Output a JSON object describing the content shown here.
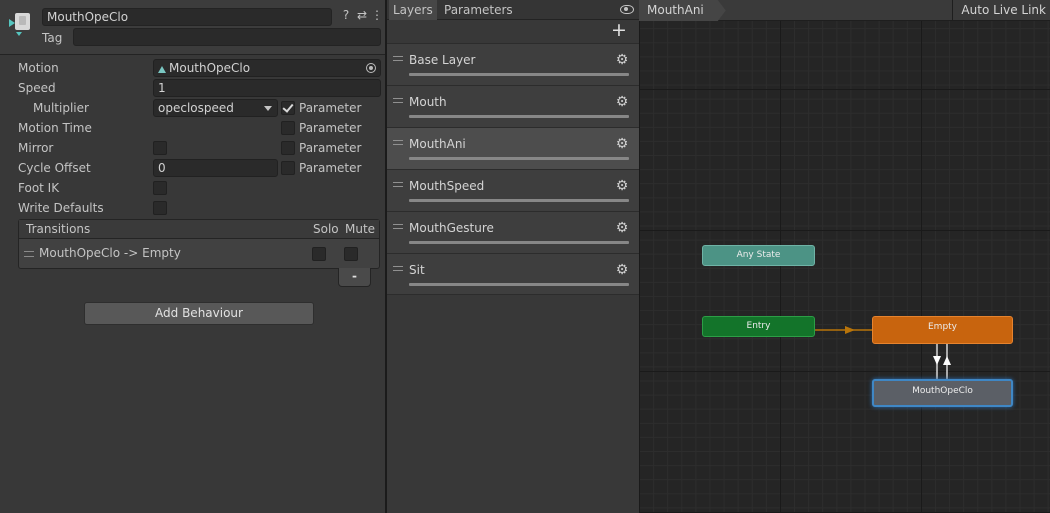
{
  "inspector": {
    "state_name": "MouthOpeClo",
    "tag_label": "Tag",
    "tag_value": "",
    "header_icons": [
      "help-icon",
      "preset-icon",
      "more-icon"
    ],
    "motion": {
      "label": "Motion",
      "value": "MouthOpeClo"
    },
    "speed": {
      "label": "Speed",
      "value": "1"
    },
    "multiplier": {
      "label": "Multiplier",
      "value": "opeclospeed",
      "parameter_label": "Parameter",
      "parameter_checked": true
    },
    "motion_time": {
      "label": "Motion Time",
      "parameter_label": "Parameter",
      "parameter_checked": false
    },
    "mirror": {
      "label": "Mirror",
      "checked": false,
      "parameter_label": "Parameter",
      "parameter_checked": false
    },
    "cycle_offset": {
      "label": "Cycle Offset",
      "value": "0",
      "parameter_label": "Parameter",
      "parameter_checked": false
    },
    "foot_ik": {
      "label": "Foot IK",
      "checked": false
    },
    "write_defaults": {
      "label": "Write Defaults",
      "checked": false
    },
    "transitions": {
      "header": "Transitions",
      "solo_label": "Solo",
      "mute_label": "Mute",
      "rows": [
        {
          "label": "MouthOpeClo -> Empty",
          "solo": false,
          "mute": false
        }
      ],
      "remove_label": "-"
    },
    "add_behaviour_label": "Add Behaviour"
  },
  "layers_panel": {
    "tabs": [
      {
        "label": "Layers",
        "active": true
      },
      {
        "label": "Parameters",
        "active": false
      }
    ],
    "add_label": "+",
    "items": [
      {
        "name": "Base Layer",
        "selected": false
      },
      {
        "name": "Mouth",
        "selected": false
      },
      {
        "name": "MouthAni",
        "selected": true
      },
      {
        "name": "MouthSpeed",
        "selected": false
      },
      {
        "name": "MouthGesture",
        "selected": false
      },
      {
        "name": "Sit",
        "selected": false
      }
    ]
  },
  "graph": {
    "breadcrumb": "MouthAni",
    "auto_live_link": "Auto Live Link",
    "nodes": {
      "any_state": "Any State",
      "entry": "Entry",
      "empty": "Empty",
      "mouth_ope_clo": "MouthOpeClo"
    }
  },
  "colors": {
    "any_state": "#4c9385",
    "entry": "#13742a",
    "default_state": "#c8640e",
    "selected_state_outline": "#3f87c5",
    "entry_transition": "#b8740a"
  }
}
